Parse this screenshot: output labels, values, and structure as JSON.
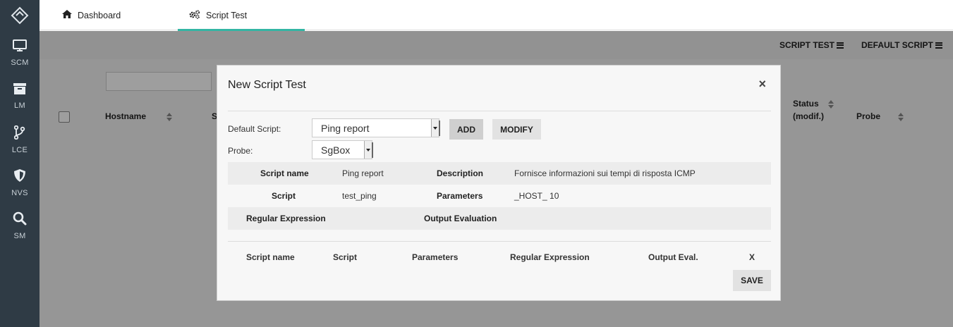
{
  "sidebar": {
    "logo_icon": "diamond-logo-icon",
    "items": [
      {
        "label": "SCM",
        "icon": "monitor-icon"
      },
      {
        "label": "LM",
        "icon": "archive-icon"
      },
      {
        "label": "LCE",
        "icon": "branch-icon"
      },
      {
        "label": "NVS",
        "icon": "shield-icon"
      },
      {
        "label": "SM",
        "icon": "search-icon"
      }
    ]
  },
  "tabs": [
    {
      "label": "Dashboard",
      "icon": "home-icon",
      "active": false
    },
    {
      "label": "Script Test",
      "icon": "cogs-icon",
      "active": true
    }
  ],
  "toolbar": {
    "script_test_label": "SCRIPT TEST",
    "default_script_label": "DEFAULT SCRIPT"
  },
  "table_bg": {
    "col_hostname": "Hostname",
    "col_s_partial": "S",
    "col_status_line1": "Status",
    "col_status_line2": "(modif.)",
    "col_probe": "Probe"
  },
  "modal": {
    "title": "New Script Test",
    "close_label": "×",
    "default_script_label": "Default Script:",
    "default_script_value": "Ping report",
    "probe_label": "Probe:",
    "probe_value": "SgBox",
    "add_label": "ADD",
    "modify_label": "MODIFY",
    "details": {
      "script_name_label": "Script name",
      "script_name_value": "Ping report",
      "description_label": "Description",
      "description_value": "Fornisce informazioni sui tempi di risposta ICMP",
      "script_label": "Script",
      "script_value": "test_ping",
      "parameters_label": "Parameters",
      "parameters_value": "_HOST_ 10",
      "regex_label": "Regular Expression",
      "output_eval_label": "Output Evaluation"
    },
    "table_headers": {
      "script_name": "Script name",
      "script": "Script",
      "parameters": "Parameters",
      "regex": "Regular Expression",
      "output_eval": "Output Eval.",
      "remove": "X"
    },
    "save_label": "SAVE"
  },
  "colors": {
    "sidebar_bg": "#2f3b45",
    "accent": "#33b5a4"
  }
}
